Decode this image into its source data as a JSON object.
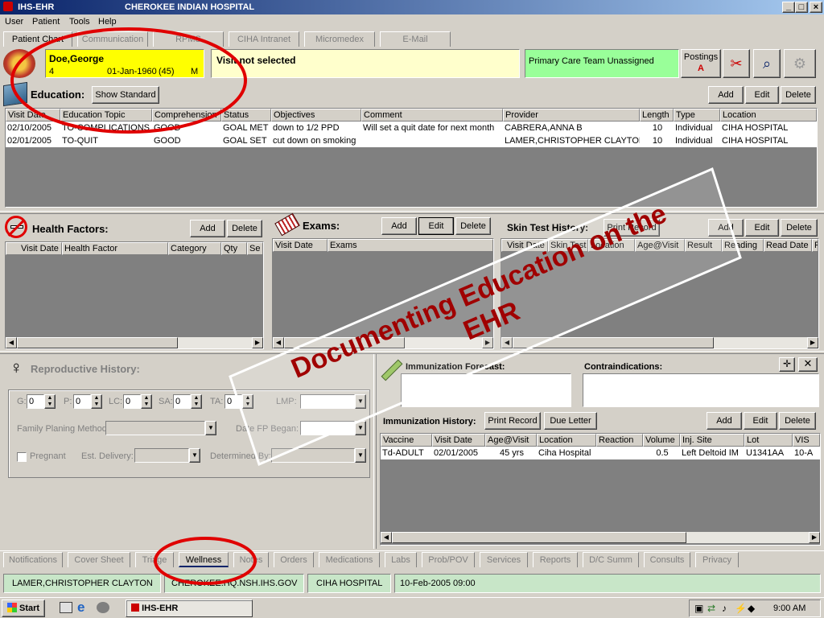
{
  "window": {
    "title": "IHS-EHR",
    "hospital": "CHEROKEE INDIAN HOSPITAL"
  },
  "menu": [
    "User",
    "Patient",
    "Tools",
    "Help"
  ],
  "top_tabs": [
    "Patient Chart",
    "Communication",
    "RPMS",
    "CIHA Intranet",
    "Micromedex",
    "E-Mail"
  ],
  "patient": {
    "name": "Doe,George",
    "id": "4",
    "dob": "01-Jan-1960",
    "age": "(45)",
    "sex": "M"
  },
  "visit": "Visit not selected",
  "care_team": "Primary Care Team Unassigned",
  "postings": {
    "label": "Postings",
    "flag": "A"
  },
  "education": {
    "title": "Education:",
    "show_standard": "Show Standard",
    "add": "Add",
    "edit": "Edit",
    "delete": "Delete",
    "columns": [
      "Visit Date",
      "Education Topic",
      "Comprehension",
      "Status",
      "Objectives",
      "Comment",
      "Provider",
      "Length",
      "Type",
      "Location"
    ],
    "rows": [
      [
        "02/10/2005",
        "TO-COMPLICATIONS",
        "GOOD",
        "GOAL MET",
        "down to 1/2 PPD",
        "Will set a quit date for next month",
        "CABRERA,ANNA B",
        "10",
        "Individual",
        "CIHA HOSPITAL"
      ],
      [
        "02/01/2005",
        "TO-QUIT",
        "GOOD",
        "GOAL SET",
        "cut down on smoking",
        "",
        "LAMER,CHRISTOPHER CLAYTON",
        "10",
        "Individual",
        "CIHA HOSPITAL"
      ]
    ]
  },
  "health_factors": {
    "title": "Health Factors:",
    "add": "Add",
    "delete": "Delete",
    "columns": [
      "Visit Date",
      "Health Factor",
      "Category",
      "Qty",
      "Se"
    ]
  },
  "exams": {
    "title": "Exams:",
    "add": "Add",
    "edit": "Edit",
    "delete": "Delete",
    "columns": [
      "Visit Date",
      "Exams"
    ]
  },
  "skin_test": {
    "title": "Skin Test History:",
    "print_record": "Print Record",
    "add": "Add",
    "edit": "Edit",
    "delete": "Delete",
    "columns": [
      "Visit Date",
      "Skin Test",
      "Location",
      "Age@Visit",
      "Result",
      "Reading",
      "Read Date",
      "F"
    ]
  },
  "reproductive": {
    "title": "Reproductive History:",
    "fields": [
      {
        "label": "G:",
        "value": "0"
      },
      {
        "label": "P:",
        "value": "0"
      },
      {
        "label": "LC:",
        "value": "0"
      },
      {
        "label": "SA:",
        "value": "0"
      },
      {
        "label": "TA:",
        "value": "0"
      }
    ],
    "lmp": "LMP:",
    "family_planning": "Family Planing Method:",
    "date_fp_began": "Date FP Began:",
    "pregnant": "Pregnant",
    "est_delivery": "Est. Delivery:",
    "determined_by": "Determined By:"
  },
  "immunization": {
    "forecast": "Immunization Forecast:",
    "contraindications": "Contraindications:",
    "history": "Immunization History:",
    "print_record": "Print Record",
    "due_letter": "Due Letter",
    "add": "Add",
    "edit": "Edit",
    "delete": "Delete",
    "columns": [
      "Vaccine",
      "Visit Date",
      "Age@Visit",
      "Location",
      "Reaction",
      "Volume",
      "Inj. Site",
      "Lot",
      "VIS"
    ],
    "rows": [
      [
        "Td-ADULT",
        "02/01/2005",
        "45 yrs",
        "Ciha Hospital",
        "",
        "0.5",
        "Left Deltoid IM",
        "U1341AA",
        "10-A"
      ]
    ]
  },
  "bottom_tabs": [
    "Notifications",
    "Cover Sheet",
    "Triage",
    "Wellness",
    "Notes",
    "Orders",
    "Medications",
    "Labs",
    "Prob/POV",
    "Services",
    "Reports",
    "D/C Summ",
    "Consults",
    "Privacy"
  ],
  "status_bar": [
    "LAMER,CHRISTOPHER CLAYTON",
    "CHEROKEE.HQ.NSH.IHS.GOV",
    "CIHA HOSPITAL",
    "10-Feb-2005 09:00"
  ],
  "taskbar": {
    "start": "Start",
    "task": "IHS-EHR",
    "time": "9:00 AM"
  },
  "overlay": {
    "line1": "Documenting Education on the",
    "line2": "EHR"
  },
  "colors": {
    "titlebar": "#0a246a",
    "patient_box": "#ffff00",
    "visit_box": "#ffffcc",
    "care_team_box": "#99ff99",
    "annotation": "#e00000",
    "overlay_text": "#a00000"
  }
}
